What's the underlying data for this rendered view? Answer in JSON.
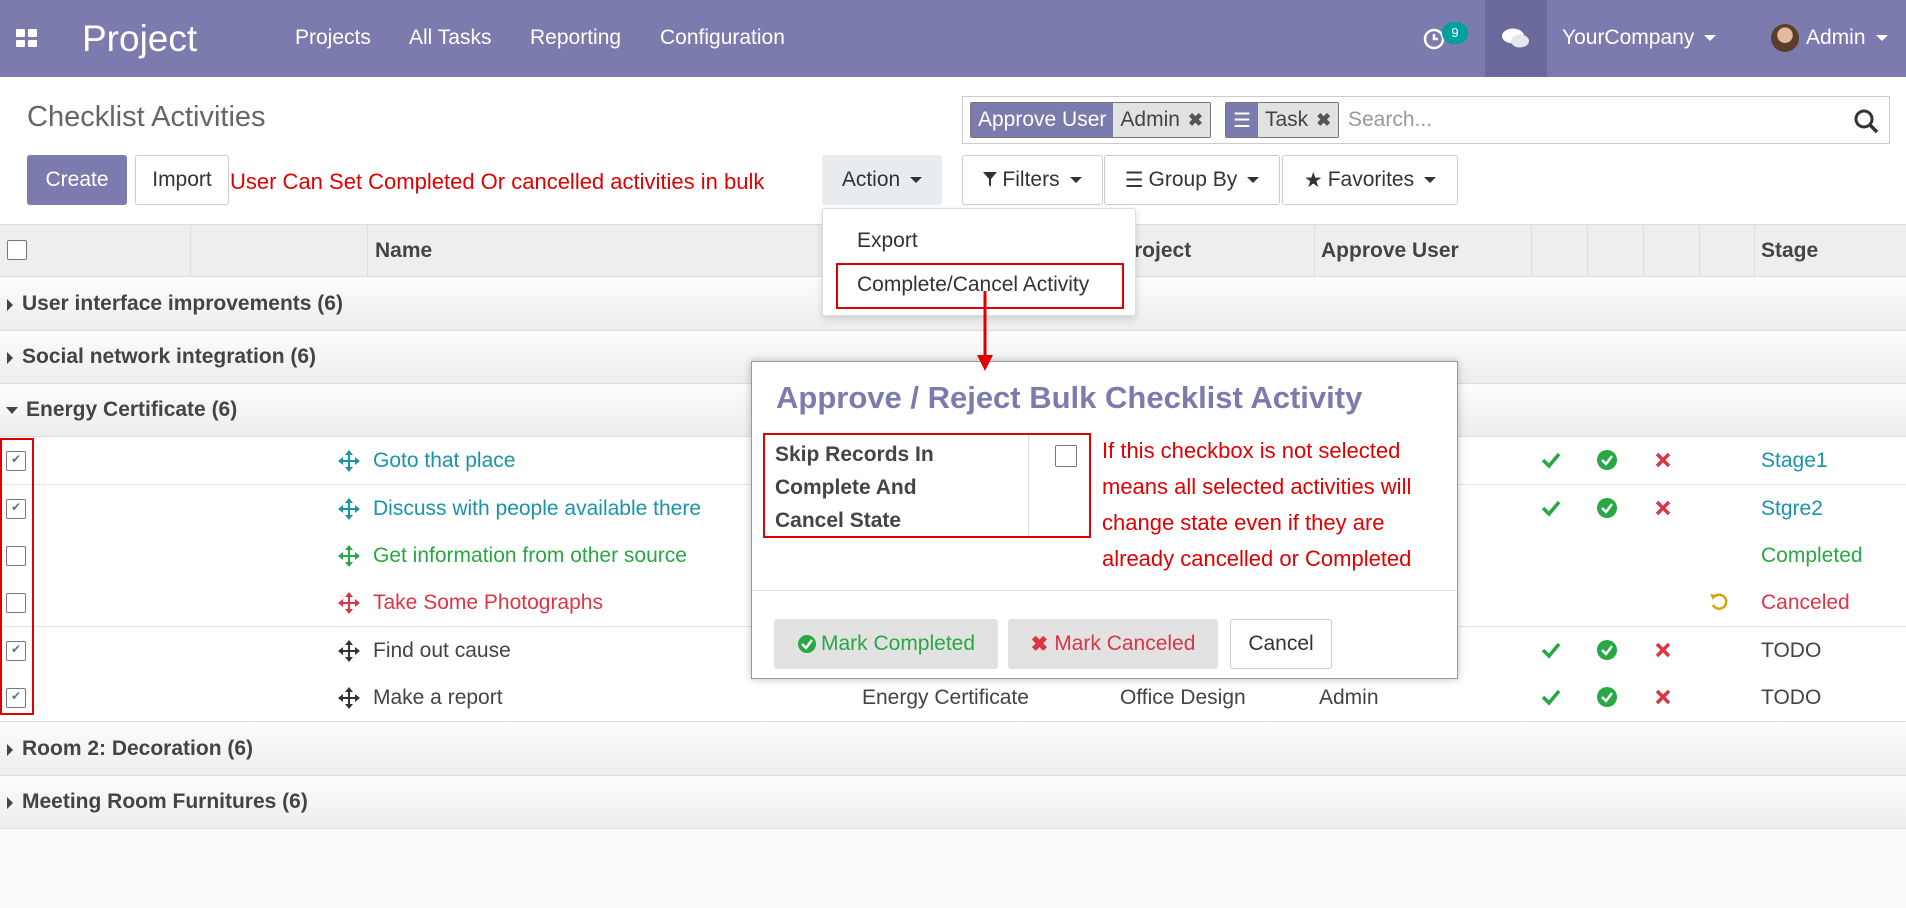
{
  "navbar": {
    "app_title": "Project",
    "menu": [
      "Projects",
      "All Tasks",
      "Reporting",
      "Configuration"
    ],
    "activity_count": "9",
    "company": "YourCompany",
    "user": "Admin",
    "color": "#7c7bad"
  },
  "control": {
    "page_title": "Checklist Activities",
    "create_label": "Create",
    "import_label": "Import",
    "annotation": "User Can Set Completed Or cancelled activities in bulk",
    "action_label": "Action",
    "filters_label": "Filters",
    "groupby_label": "Group By",
    "favorites_label": "Favorites",
    "search_placeholder": "Search...",
    "facets": [
      {
        "label": "Approve User",
        "value": "Admin"
      },
      {
        "label": "",
        "value": "Task"
      }
    ]
  },
  "action_menu": {
    "items": [
      "Export",
      "Complete/Cancel Activity"
    ]
  },
  "list": {
    "columns": {
      "name": "Name",
      "project": "Project",
      "approve_user": "Approve User",
      "stage": "Stage"
    },
    "groups_before": [
      {
        "label": "User interface improvements (6)"
      },
      {
        "label": "Social network integration (6)"
      },
      {
        "label": "Energy Certificate (6)"
      }
    ],
    "rows": [
      {
        "checked": true,
        "name": "Goto that place",
        "stage": "Stage1",
        "name_color": "#1a93a7",
        "stage_color": "#1a93a7",
        "icons": "actions"
      },
      {
        "checked": true,
        "name": "Discuss with people available there",
        "stage": "Stgre2",
        "name_color": "#1a93a7",
        "stage_color": "#1a93a7",
        "icons": "actions"
      },
      {
        "checked": false,
        "name": "Get information from other source",
        "stage": "Completed",
        "name_color": "#28a745",
        "stage_color": "#28a745",
        "icons": "none"
      },
      {
        "checked": false,
        "name": "Take Some Photographs",
        "stage": "Canceled",
        "name_color": "#dc3545",
        "stage_color": "#dc3545",
        "icons": "undo"
      },
      {
        "checked": true,
        "name": "Find out cause",
        "stage": "TODO",
        "name_color": "#444444",
        "stage_color": "#444444",
        "icons": "actions"
      },
      {
        "checked": true,
        "name": "Make a report",
        "stage": "TODO",
        "name_color": "#444444",
        "stage_color": "#444444",
        "icons": "actions",
        "task": "Energy Certificate",
        "project": "Office Design",
        "approve_user": "Admin"
      }
    ],
    "groups_after": [
      {
        "label": "Room 2: Decoration (6)"
      },
      {
        "label": "Meeting Room Furnitures (6)"
      }
    ]
  },
  "modal": {
    "title": "Approve / Reject Bulk Checklist Activity",
    "field_label": "Skip Records In Complete And Cancel State",
    "note": "If this checkbox is not selected means all selected activities will change state even if they are already cancelled or Completed",
    "mark_completed": "Mark Completed",
    "mark_canceled": "Mark Canceled",
    "cancel": "Cancel"
  }
}
